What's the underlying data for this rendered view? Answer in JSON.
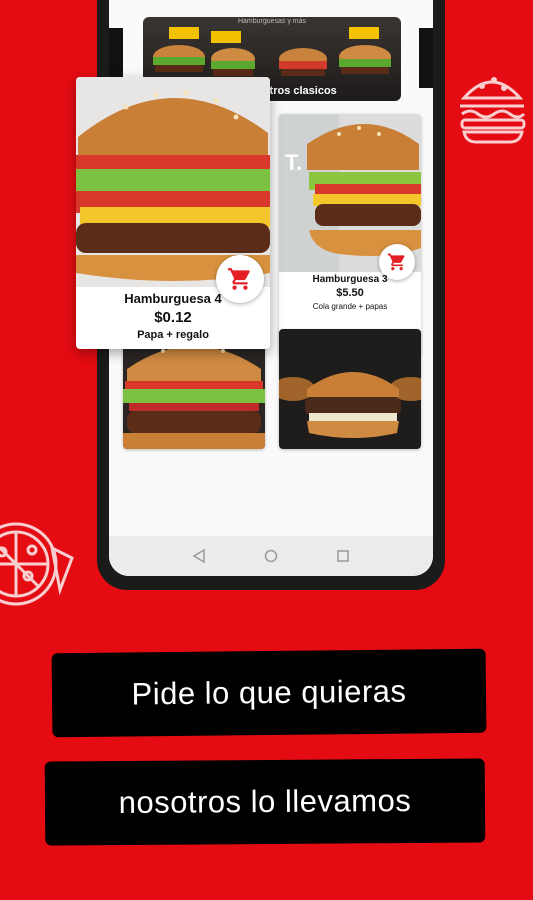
{
  "banner": {
    "top_text": "Hamburguesas y más",
    "caption": "Combos Metros clasicos"
  },
  "products": [
    {
      "name": "Hamburguesa 4",
      "price": "$0.12",
      "description": "Papa + regalo"
    },
    {
      "name": "Hamburguesa 3",
      "price": "$5.50",
      "description": "Cola grande + papas"
    }
  ],
  "promo_text": {
    "line1": "Pide lo que quieras",
    "line2": "nosotros lo llevamos"
  },
  "icons": {
    "cart": "shopping-cart-icon",
    "burger_deco": "burger-outline-icon",
    "pizza_deco": "pizza-outline-icon",
    "back": "back-icon",
    "home": "home-icon",
    "recents": "recents-icon"
  },
  "colors": {
    "background": "#e40c12",
    "accent": "#e31e24",
    "phone": "#1b1b1b",
    "promo_bg": "#000000"
  }
}
